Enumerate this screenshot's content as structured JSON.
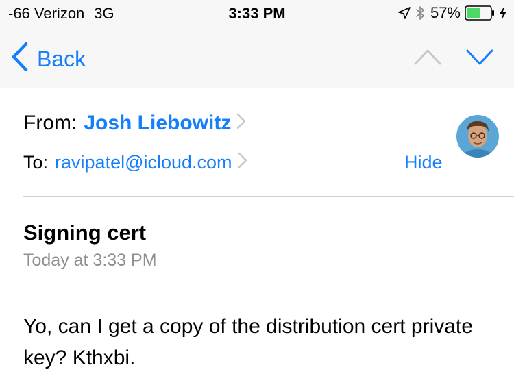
{
  "status_bar": {
    "carrier": "-66 Verizon",
    "network": "3G",
    "time": "3:33 PM",
    "battery_percent": "57%",
    "battery_level": 0.57,
    "icons": [
      "location-arrow-icon",
      "bluetooth-icon",
      "battery-icon",
      "charging-bolt-icon"
    ]
  },
  "nav": {
    "back_label": "Back",
    "icons": [
      "chevron-left-icon",
      "chevron-up-icon",
      "chevron-down-icon"
    ],
    "accent_color": "#147efb",
    "disabled_color": "#c7c7cc"
  },
  "header": {
    "from_label": "From:",
    "from_name": "Josh Liebowitz",
    "to_label": "To:",
    "to_address": "ravipatel@icloud.com",
    "hide_label": "Hide"
  },
  "message": {
    "subject": "Signing cert",
    "date": "Today at 3:33 PM",
    "body": "Yo, can I get a copy of the distribution cert private key? Kthxbi."
  }
}
